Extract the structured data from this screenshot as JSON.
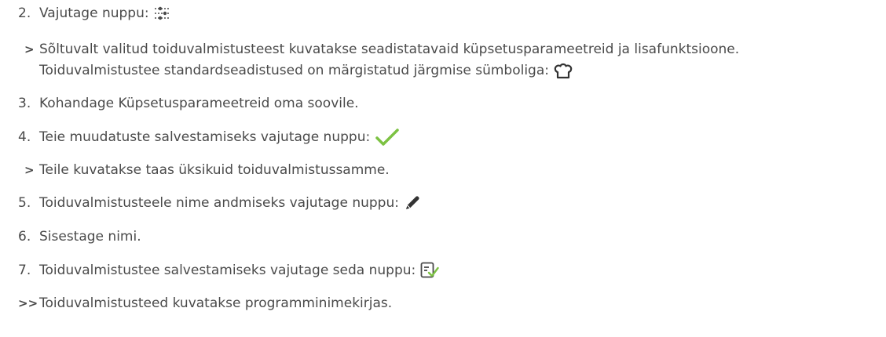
{
  "steps": [
    {
      "marker": "2.",
      "text": "Vajutage nuppu:",
      "icon": "sliders-icon"
    },
    {
      "marker": ">",
      "text": "Sõltuvalt valitud toiduvalmistusteest kuvatakse seadistatavaid küpsetusparameetreid ja lisafunktsioone."
    },
    {
      "marker": "",
      "text": "Toiduvalmistustee standardseadistused on märgistatud järgmise sümboliga:",
      "icon": "chef-hat-icon"
    },
    {
      "marker": "3.",
      "text": "Kohandage Küpsetusparameetreid oma soovile."
    },
    {
      "marker": "4.",
      "text": "Teie muudatuste salvestamiseks vajutage nuppu:",
      "icon": "checkmark-icon"
    },
    {
      "marker": ">",
      "text": "Teile kuvatakse taas üksikuid toiduvalmistussamme."
    },
    {
      "marker": "5.",
      "text": "Toiduvalmistusteele nime andmiseks vajutage nuppu:",
      "icon": "pencil-icon"
    },
    {
      "marker": "6.",
      "text": "Sisestage nimi."
    },
    {
      "marker": "7.",
      "text": "Toiduvalmistustee salvestamiseks vajutage seda nuppu:",
      "icon": "save-list-icon"
    },
    {
      "marker": ">>",
      "text": "Toiduvalmistusteed kuvatakse programminimekirjas."
    }
  ],
  "colors": {
    "text": "#4a4a4a",
    "accent_green": "#7cc242"
  }
}
